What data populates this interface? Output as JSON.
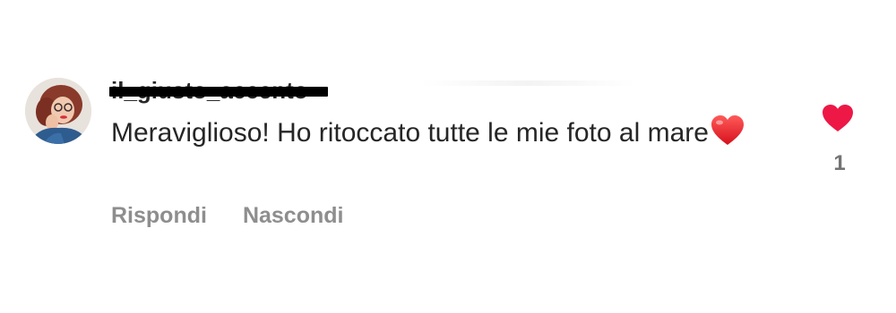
{
  "comment": {
    "username": "il_giusto_accento",
    "text": "Meraviglioso! Ho ritoccato tutte le mie foto al mare",
    "emoji": "red-heart-emoji",
    "actions": {
      "reply_label": "Rispondi",
      "hide_label": "Nascondi"
    },
    "likes": {
      "count": "1",
      "liked": true,
      "heart_color": "#ed1846"
    }
  },
  "colors": {
    "primary_text": "#262626",
    "secondary_text": "#8e8e8e",
    "like_heart": "#ed1846"
  },
  "icons": {
    "like": "heart-icon",
    "avatar": "avatar"
  }
}
